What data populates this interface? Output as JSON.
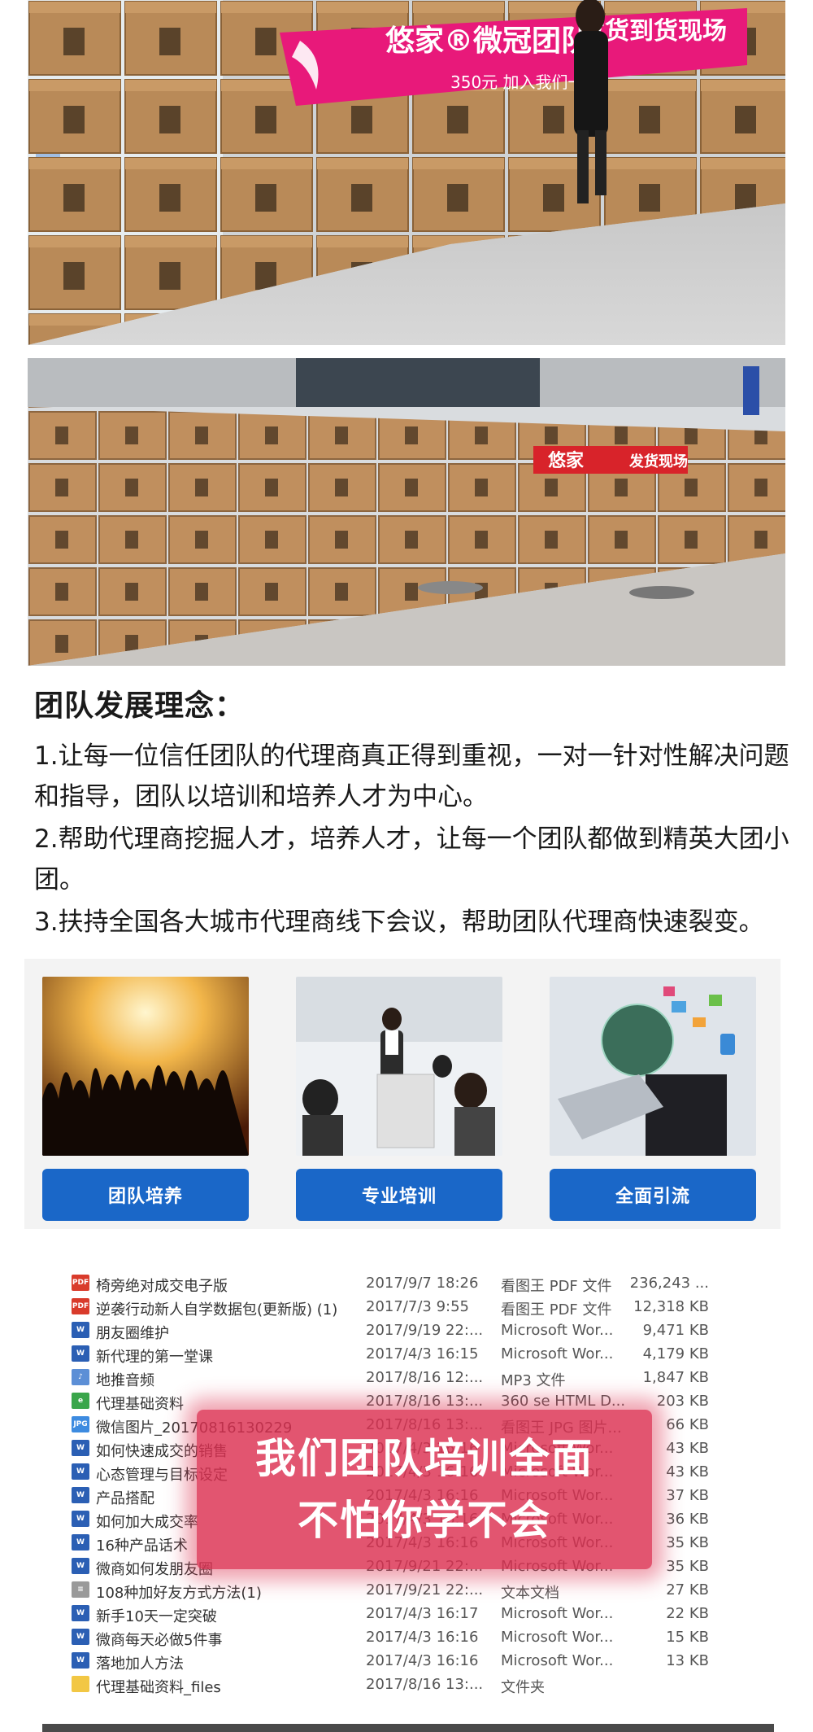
{
  "photo_top": {
    "banner_text": "悠家®微冠团队",
    "banner_text_2": "发货到货现场",
    "banner_sub": "350元 加入我们一起"
  },
  "photo_bottom": {
    "banner_text": "悠家",
    "banner_text_2": "发货现场"
  },
  "section": {
    "title": "团队发展理念：",
    "paragraphs": [
      "1.让每一位信任团队的代理商真正得到重视，一对一针对性解决问题和指导，团队以培训和培养人才为中心。",
      "2.帮助代理商挖掘人才，培养人才，让每一个团队都做到精英大团小团。",
      "3.扶持全国各大城市代理商线下会议，帮助团队代理商快速裂变。"
    ]
  },
  "features": [
    {
      "label": "团队培养",
      "icon": "concert-crowd-image"
    },
    {
      "label": "专业培训",
      "icon": "classroom-training-image"
    },
    {
      "label": "全面引流",
      "icon": "tech-globe-image"
    }
  ],
  "files": [
    {
      "name": "椅旁绝对成交电子版",
      "date": "2017/9/7 18:26",
      "type": "看图王 PDF 文件",
      "size": "236,243 ...",
      "icon": "PDF",
      "color": "#d93b2b"
    },
    {
      "name": "逆袭行动新人自学数据包(更新版) (1)",
      "date": "2017/7/3 9:55",
      "type": "看图王 PDF 文件",
      "size": "12,318 KB",
      "icon": "PDF",
      "color": "#d93b2b"
    },
    {
      "name": "朋友圈维护",
      "date": "2017/9/19 22:...",
      "type": "Microsoft Wor...",
      "size": "9,471 KB",
      "icon": "W",
      "color": "#2b5fb4"
    },
    {
      "name": "新代理的第一堂课",
      "date": "2017/4/3 16:15",
      "type": "Microsoft Wor...",
      "size": "4,179 KB",
      "icon": "W",
      "color": "#2b5fb4"
    },
    {
      "name": "地推音频",
      "date": "2017/8/16 12:...",
      "type": "MP3 文件",
      "size": "1,847 KB",
      "icon": "♪",
      "color": "#5c8fd6"
    },
    {
      "name": "代理基础资料",
      "date": "2017/8/16 13:...",
      "type": "360 se HTML D...",
      "size": "203 KB",
      "icon": "e",
      "color": "#3aa64b"
    },
    {
      "name": "微信图片_20170816130229",
      "date": "2017/8/16 13:...",
      "type": "看图王 JPG 图片...",
      "size": "66 KB",
      "icon": "JPG",
      "color": "#3d8be0"
    },
    {
      "name": "如何快速成交的销售",
      "date": "2017/4/3 16:16",
      "type": "Microsoft Wor...",
      "size": "43 KB",
      "icon": "W",
      "color": "#2b5fb4"
    },
    {
      "name": "心态管理与目标设定",
      "date": "2017/4/3 16:16",
      "type": "Microsoft Wor...",
      "size": "43 KB",
      "icon": "W",
      "color": "#2b5fb4"
    },
    {
      "name": "产品搭配",
      "date": "2017/4/3 16:16",
      "type": "Microsoft Wor...",
      "size": "37 KB",
      "icon": "W",
      "color": "#2b5fb4"
    },
    {
      "name": "如何加大成交率",
      "date": "2017/4/3 16:16",
      "type": "Microsoft Wor...",
      "size": "36 KB",
      "icon": "W",
      "color": "#2b5fb4"
    },
    {
      "name": "16种产品话术",
      "date": "2017/4/3 16:16",
      "type": "Microsoft Wor...",
      "size": "35 KB",
      "icon": "W",
      "color": "#2b5fb4"
    },
    {
      "name": "微商如何发朋友圈",
      "date": "2017/9/21 22:...",
      "type": "Microsoft Wor...",
      "size": "35 KB",
      "icon": "W",
      "color": "#2b5fb4"
    },
    {
      "name": "108种加好友方式方法(1)",
      "date": "2017/9/21 22:...",
      "type": "文本文档",
      "size": "27 KB",
      "icon": "≡",
      "color": "#9a9a9a"
    },
    {
      "name": "新手10天一定突破",
      "date": "2017/4/3 16:17",
      "type": "Microsoft Wor...",
      "size": "22 KB",
      "icon": "W",
      "color": "#2b5fb4"
    },
    {
      "name": "微商每天必做5件事",
      "date": "2017/4/3 16:16",
      "type": "Microsoft Wor...",
      "size": "15 KB",
      "icon": "W",
      "color": "#2b5fb4"
    },
    {
      "name": "落地加人方法",
      "date": "2017/4/3 16:16",
      "type": "Microsoft Wor...",
      "size": "13 KB",
      "icon": "W",
      "color": "#2b5fb4"
    },
    {
      "name": "代理基础资料_files",
      "date": "2017/8/16 13:...",
      "type": "文件夹",
      "size": "",
      "icon": "",
      "color": "#f2c744"
    }
  ],
  "overlay": {
    "line1": "我们团队培训全面",
    "line2": "不怕你学不会"
  },
  "colors": {
    "button_blue": "#1a67c8",
    "banner_pink": "#e8197a",
    "overlay_red": "#dc3050"
  }
}
